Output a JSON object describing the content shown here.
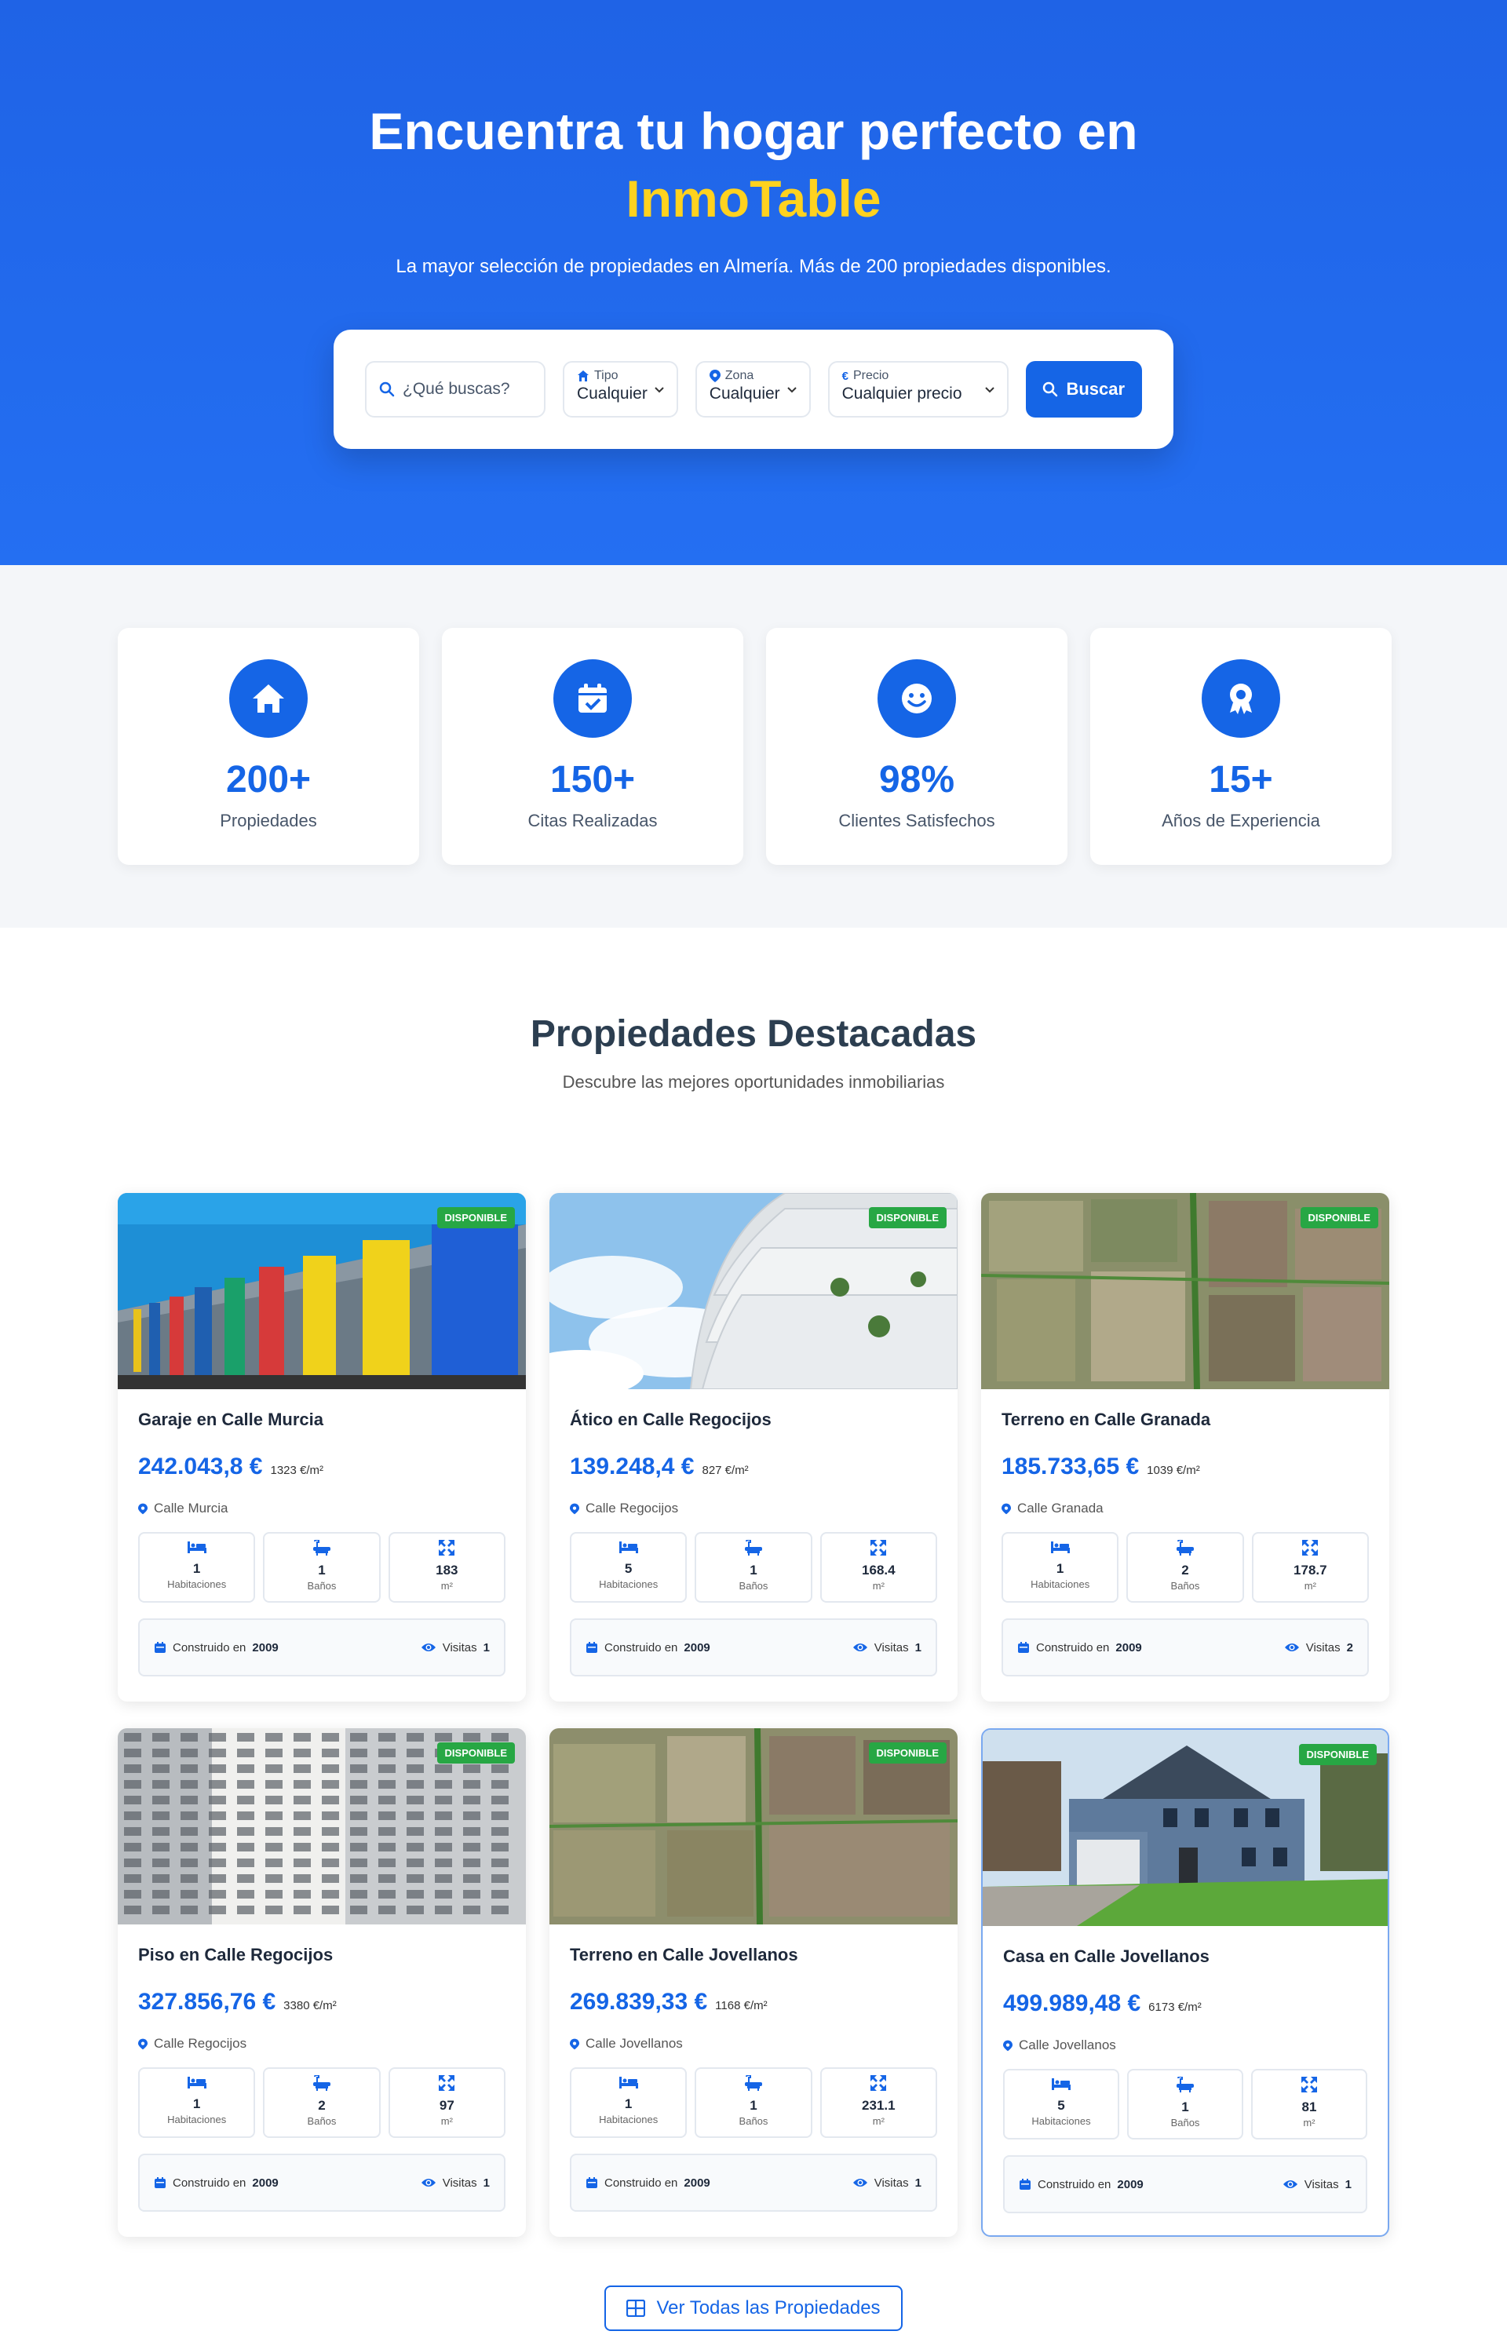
{
  "hero": {
    "title": "Encuentra tu hogar perfecto en",
    "brand": "InmoTable",
    "subtitle": "La mayor selección de propiedades en Almería. Más de 200 propiedades disponibles."
  },
  "search": {
    "query_placeholder": "¿Qué buscas?",
    "tipo_label": "Tipo",
    "tipo_value": "Cualquier",
    "zona_label": "Zona",
    "zona_value": "Cualquier",
    "precio_label": "Precio",
    "precio_value": "Cualquier precio",
    "button": "Buscar"
  },
  "stats": [
    {
      "value": "200+",
      "label": "Propiedades",
      "icon": "home-icon"
    },
    {
      "value": "150+",
      "label": "Citas Realizadas",
      "icon": "calendar-check-icon"
    },
    {
      "value": "98%",
      "label": "Clientes Satisfechos",
      "icon": "smile-icon"
    },
    {
      "value": "15+",
      "label": "Años de Experiencia",
      "icon": "award-icon"
    }
  ],
  "featured": {
    "title": "Propiedades Destacadas",
    "subtitle": "Descubre las mejores oportunidades inmobiliarias",
    "view_all": "Ver Todas las Propiedades",
    "labels": {
      "habitaciones": "Habitaciones",
      "banos": "Baños",
      "m2": "m²",
      "built": "Construido en",
      "visits": "Visitas"
    },
    "properties": [
      {
        "status": "DISPONIBLE",
        "title": "Garaje en Calle Murcia",
        "price": "242.043,8 €",
        "price_m2": "1323 €/m²",
        "address": "Calle Murcia",
        "rooms": "1",
        "baths": "1",
        "area": "183",
        "year": "2009",
        "visits": "1"
      },
      {
        "status": "DISPONIBLE",
        "title": "Ático en Calle Regocijos",
        "price": "139.248,4 €",
        "price_m2": "827 €/m²",
        "address": "Calle Regocijos",
        "rooms": "5",
        "baths": "1",
        "area": "168.4",
        "year": "2009",
        "visits": "1"
      },
      {
        "status": "DISPONIBLE",
        "title": "Terreno en Calle Granada",
        "price": "185.733,65 €",
        "price_m2": "1039 €/m²",
        "address": "Calle Granada",
        "rooms": "1",
        "baths": "2",
        "area": "178.7",
        "year": "2009",
        "visits": "2"
      },
      {
        "status": "DISPONIBLE",
        "title": "Piso en Calle Regocijos",
        "price": "327.856,76 €",
        "price_m2": "3380 €/m²",
        "address": "Calle Regocijos",
        "rooms": "1",
        "baths": "2",
        "area": "97",
        "year": "2009",
        "visits": "1"
      },
      {
        "status": "DISPONIBLE",
        "title": "Terreno en Calle Jovellanos",
        "price": "269.839,33 €",
        "price_m2": "1168 €/m²",
        "address": "Calle Jovellanos",
        "rooms": "1",
        "baths": "1",
        "area": "231.1",
        "year": "2009",
        "visits": "1"
      },
      {
        "status": "DISPONIBLE",
        "title": "Casa en Calle Jovellanos",
        "price": "499.989,48 €",
        "price_m2": "6173 €/m²",
        "address": "Calle Jovellanos",
        "rooms": "5",
        "baths": "1",
        "area": "81",
        "year": "2009",
        "visits": "1"
      }
    ]
  },
  "colors": {
    "primary": "#1565e6",
    "accent": "#ffd21f",
    "success": "#27a744"
  }
}
